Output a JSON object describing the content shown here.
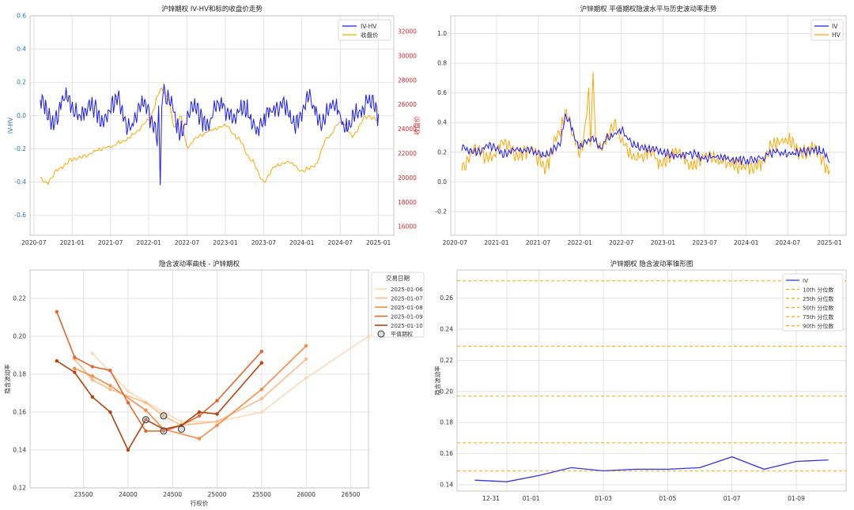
{
  "chart_data": [
    {
      "type": "line",
      "title": "沪锌期权 IV-HV和标的收盘价走势",
      "xlabel": "",
      "ylabel": "IV-HV",
      "y2label": "收盘价",
      "ylim": [
        -0.72,
        0.6
      ],
      "y2lim": [
        15300,
        33300
      ],
      "y_ticks": [
        -0.6,
        -0.4,
        -0.2,
        0.0,
        0.2,
        0.4,
        0.6
      ],
      "y2_ticks": [
        16000,
        18000,
        20000,
        22000,
        24000,
        26000,
        28000,
        30000,
        32000
      ],
      "x_ticks": [
        "2020-07",
        "2021-01",
        "2021-07",
        "2022-01",
        "2022-07",
        "2023-01",
        "2023-07",
        "2024-01",
        "2024-07",
        "2025-01"
      ],
      "legend": [
        "IV-HV",
        "收盘价"
      ],
      "legend_position": "top-right",
      "colors": {
        "iv_hv": "#1a1aff",
        "close": "#ffa500",
        "left_axis": "#1f77b4",
        "right_axis": "#d62728"
      },
      "series": [
        {
          "name": "IV-HV",
          "axis": "left",
          "x": [
            "2020-08",
            "2020-10",
            "2020-12",
            "2021-02",
            "2021-04",
            "2021-06",
            "2021-08",
            "2021-10",
            "2021-12",
            "2022-02",
            "2022-03",
            "2022-03",
            "2022-04",
            "2022-06",
            "2022-08",
            "2022-10",
            "2022-12",
            "2023-02",
            "2023-04",
            "2023-06",
            "2023-08",
            "2023-10",
            "2023-12",
            "2024-02",
            "2024-04",
            "2024-06",
            "2024-08",
            "2024-10",
            "2024-12",
            "2025-01"
          ],
          "values": [
            0.1,
            -0.05,
            0.12,
            0.0,
            0.05,
            -0.03,
            0.1,
            -0.08,
            0.07,
            -0.05,
            -0.42,
            0.15,
            0.12,
            -0.1,
            0.05,
            -0.06,
            0.08,
            0.0,
            0.05,
            -0.08,
            0.02,
            0.07,
            -0.05,
            0.1,
            -0.04,
            0.08,
            -0.08,
            0.03,
            0.1,
            0.0
          ]
        },
        {
          "name": "收盘价",
          "axis": "right",
          "x": [
            "2020-08",
            "2020-09",
            "2020-11",
            "2021-01",
            "2021-03",
            "2021-05",
            "2021-07",
            "2021-09",
            "2021-11",
            "2022-01",
            "2022-03",
            "2022-04",
            "2022-05",
            "2022-06",
            "2022-07",
            "2022-09",
            "2022-11",
            "2023-01",
            "2023-03",
            "2023-05",
            "2023-07",
            "2023-09",
            "2023-11",
            "2024-01",
            "2024-03",
            "2024-05",
            "2024-07",
            "2024-09",
            "2024-11",
            "2025-01"
          ],
          "values": [
            20000,
            19600,
            20800,
            21500,
            21800,
            22300,
            22600,
            23000,
            23700,
            24800,
            27300,
            26500,
            24200,
            25000,
            22600,
            23500,
            24000,
            24300,
            23300,
            21500,
            19700,
            21000,
            21300,
            20600,
            21000,
            23300,
            24600,
            23500,
            25000,
            24800
          ]
        }
      ]
    },
    {
      "type": "line",
      "title": "沪锌期权 平值期权隐波水平与历史波动率走势",
      "xlabel": "",
      "ylabel": "",
      "ylim": [
        -0.36,
        1.12
      ],
      "y_ticks": [
        -0.2,
        0.0,
        0.2,
        0.4,
        0.6,
        0.8,
        1.0
      ],
      "x_ticks": [
        "2020-07",
        "2021-01",
        "2021-07",
        "2022-01",
        "2022-07",
        "2023-01",
        "2023-07",
        "2024-01",
        "2024-07",
        "2025-01"
      ],
      "legend": [
        "IV",
        "HV"
      ],
      "legend_position": "top-right",
      "colors": {
        "IV": "#1a1aff",
        "HV": "#ffa500"
      },
      "series": [
        {
          "name": "IV",
          "x": [
            "2020-08",
            "2020-10",
            "2020-12",
            "2021-02",
            "2021-04",
            "2021-06",
            "2021-08",
            "2021-10",
            "2021-11",
            "2022-01",
            "2022-03",
            "2022-04",
            "2022-05",
            "2022-07",
            "2022-09",
            "2022-11",
            "2023-01",
            "2023-03",
            "2023-05",
            "2023-07",
            "2023-09",
            "2023-11",
            "2024-01",
            "2024-03",
            "2024-05",
            "2024-07",
            "2024-09",
            "2024-11",
            "2024-12",
            "2025-01"
          ],
          "values": [
            0.23,
            0.2,
            0.24,
            0.19,
            0.22,
            0.21,
            0.18,
            0.25,
            0.44,
            0.24,
            0.3,
            0.22,
            0.3,
            0.34,
            0.24,
            0.22,
            0.2,
            0.17,
            0.19,
            0.16,
            0.17,
            0.15,
            0.14,
            0.16,
            0.2,
            0.19,
            0.2,
            0.22,
            0.2,
            0.15
          ]
        },
        {
          "name": "HV",
          "x": [
            "2020-08",
            "2020-10",
            "2020-12",
            "2021-02",
            "2021-04",
            "2021-06",
            "2021-08",
            "2021-10",
            "2021-11",
            "2022-01",
            "2022-03",
            "2022-03",
            "2022-04",
            "2022-06",
            "2022-07",
            "2022-09",
            "2022-11",
            "2023-01",
            "2023-03",
            "2023-05",
            "2023-07",
            "2023-09",
            "2023-11",
            "2024-01",
            "2024-03",
            "2024-05",
            "2024-07",
            "2024-09",
            "2024-11",
            "2025-01"
          ],
          "values": [
            0.1,
            0.22,
            0.16,
            0.26,
            0.18,
            0.22,
            0.1,
            0.32,
            0.46,
            0.2,
            0.74,
            0.2,
            0.22,
            0.38,
            0.28,
            0.16,
            0.2,
            0.12,
            0.22,
            0.1,
            0.18,
            0.14,
            0.12,
            0.1,
            0.12,
            0.26,
            0.28,
            0.2,
            0.22,
            0.08
          ]
        }
      ]
    },
    {
      "type": "line",
      "title": "隐含波动率曲线 - 沪锌期权",
      "xlabel": "行权价",
      "ylabel": "隐含波动率",
      "xlim": [
        22900,
        26700
      ],
      "ylim": [
        0.12,
        0.235
      ],
      "x_ticks": [
        23500,
        24000,
        24500,
        25000,
        25500,
        26000,
        26500
      ],
      "y_ticks": [
        0.12,
        0.14,
        0.16,
        0.18,
        0.2,
        0.22
      ],
      "legend_title": "交易日期",
      "legend": [
        "2025-01-06",
        "2025-01-07",
        "2025-01-08",
        "2025-01-09",
        "2025-01-10",
        "平值期权"
      ],
      "legend_position": "top-right",
      "series": [
        {
          "name": "2025-01-06",
          "color": "#fdd9b8",
          "x": [
            23600,
            24000,
            24400,
            24600,
            25000,
            25500,
            26000,
            26700
          ],
          "values": [
            0.191,
            0.171,
            0.16,
            0.155,
            0.155,
            0.16,
            0.178,
            0.2
          ]
        },
        {
          "name": "2025-01-07",
          "color": "#fdbb84",
          "x": [
            23400,
            23600,
            23800,
            24200,
            24400,
            24600,
            25000,
            25500,
            26000
          ],
          "values": [
            0.188,
            0.177,
            0.172,
            0.165,
            0.158,
            0.153,
            0.155,
            0.167,
            0.188
          ]
        },
        {
          "name": "2025-01-08",
          "color": "#fb8a45",
          "x": [
            23400,
            23600,
            23800,
            24200,
            24400,
            24800,
            25000,
            25500,
            26000
          ],
          "values": [
            0.183,
            0.179,
            0.174,
            0.161,
            0.151,
            0.146,
            0.153,
            0.172,
            0.195
          ]
        },
        {
          "name": "2025-01-09",
          "color": "#e8642a",
          "x": [
            23200,
            23400,
            23600,
            23800,
            24000,
            24200,
            24400,
            24600,
            24800,
            25000,
            25500
          ],
          "values": [
            0.213,
            0.189,
            0.184,
            0.182,
            0.165,
            0.15,
            0.15,
            0.153,
            0.158,
            0.166,
            0.192
          ]
        },
        {
          "name": "2025-01-10",
          "color": "#b34510",
          "x": [
            23200,
            23400,
            23600,
            23800,
            24000,
            24200,
            24400,
            24600,
            24800,
            25000,
            25500
          ],
          "values": [
            0.187,
            0.181,
            0.168,
            0.16,
            0.14,
            0.156,
            0.151,
            0.153,
            0.16,
            0.159,
            0.186
          ]
        }
      ],
      "atm_points": {
        "name": "平值期权",
        "x": [
          24200,
          24400,
          24400,
          24600
        ],
        "values": [
          0.156,
          0.158,
          0.15,
          0.151
        ]
      }
    },
    {
      "type": "line",
      "title": "沪锌期权 隐含波动率锥形图",
      "xlabel": "",
      "ylabel": "隐含波动率",
      "ylim": [
        0.136,
        0.278
      ],
      "y_ticks": [
        0.14,
        0.16,
        0.18,
        0.2,
        0.22,
        0.24,
        0.26
      ],
      "x_ticks": [
        "12-31",
        "01-01",
        "01-03",
        "01-05",
        "01-07",
        "01-09"
      ],
      "legend": [
        "IV",
        "10th 分位数",
        "25th 分位数",
        "50th 分位数",
        "75th 分位数",
        "90th 分位数"
      ],
      "legend_position": "top-right",
      "colors": {
        "IV": "#3333ee",
        "percentile": "#ffa500"
      },
      "series": [
        {
          "name": "IV",
          "x": [
            "12-30",
            "12-31",
            "01-01",
            "01-02",
            "01-03",
            "01-04",
            "01-05",
            "01-06",
            "01-07",
            "01-08",
            "01-09",
            "01-10"
          ],
          "values": [
            0.143,
            0.142,
            0.146,
            0.151,
            0.149,
            0.15,
            0.15,
            0.151,
            0.158,
            0.15,
            0.155,
            0.156
          ]
        }
      ],
      "percentiles": [
        {
          "name": "10th 分位数",
          "value": 0.149
        },
        {
          "name": "25th 分位数",
          "value": 0.167
        },
        {
          "name": "50th 分位数",
          "value": 0.197
        },
        {
          "name": "75th 分位数",
          "value": 0.229
        },
        {
          "name": "90th 分位数",
          "value": 0.271
        }
      ]
    }
  ]
}
